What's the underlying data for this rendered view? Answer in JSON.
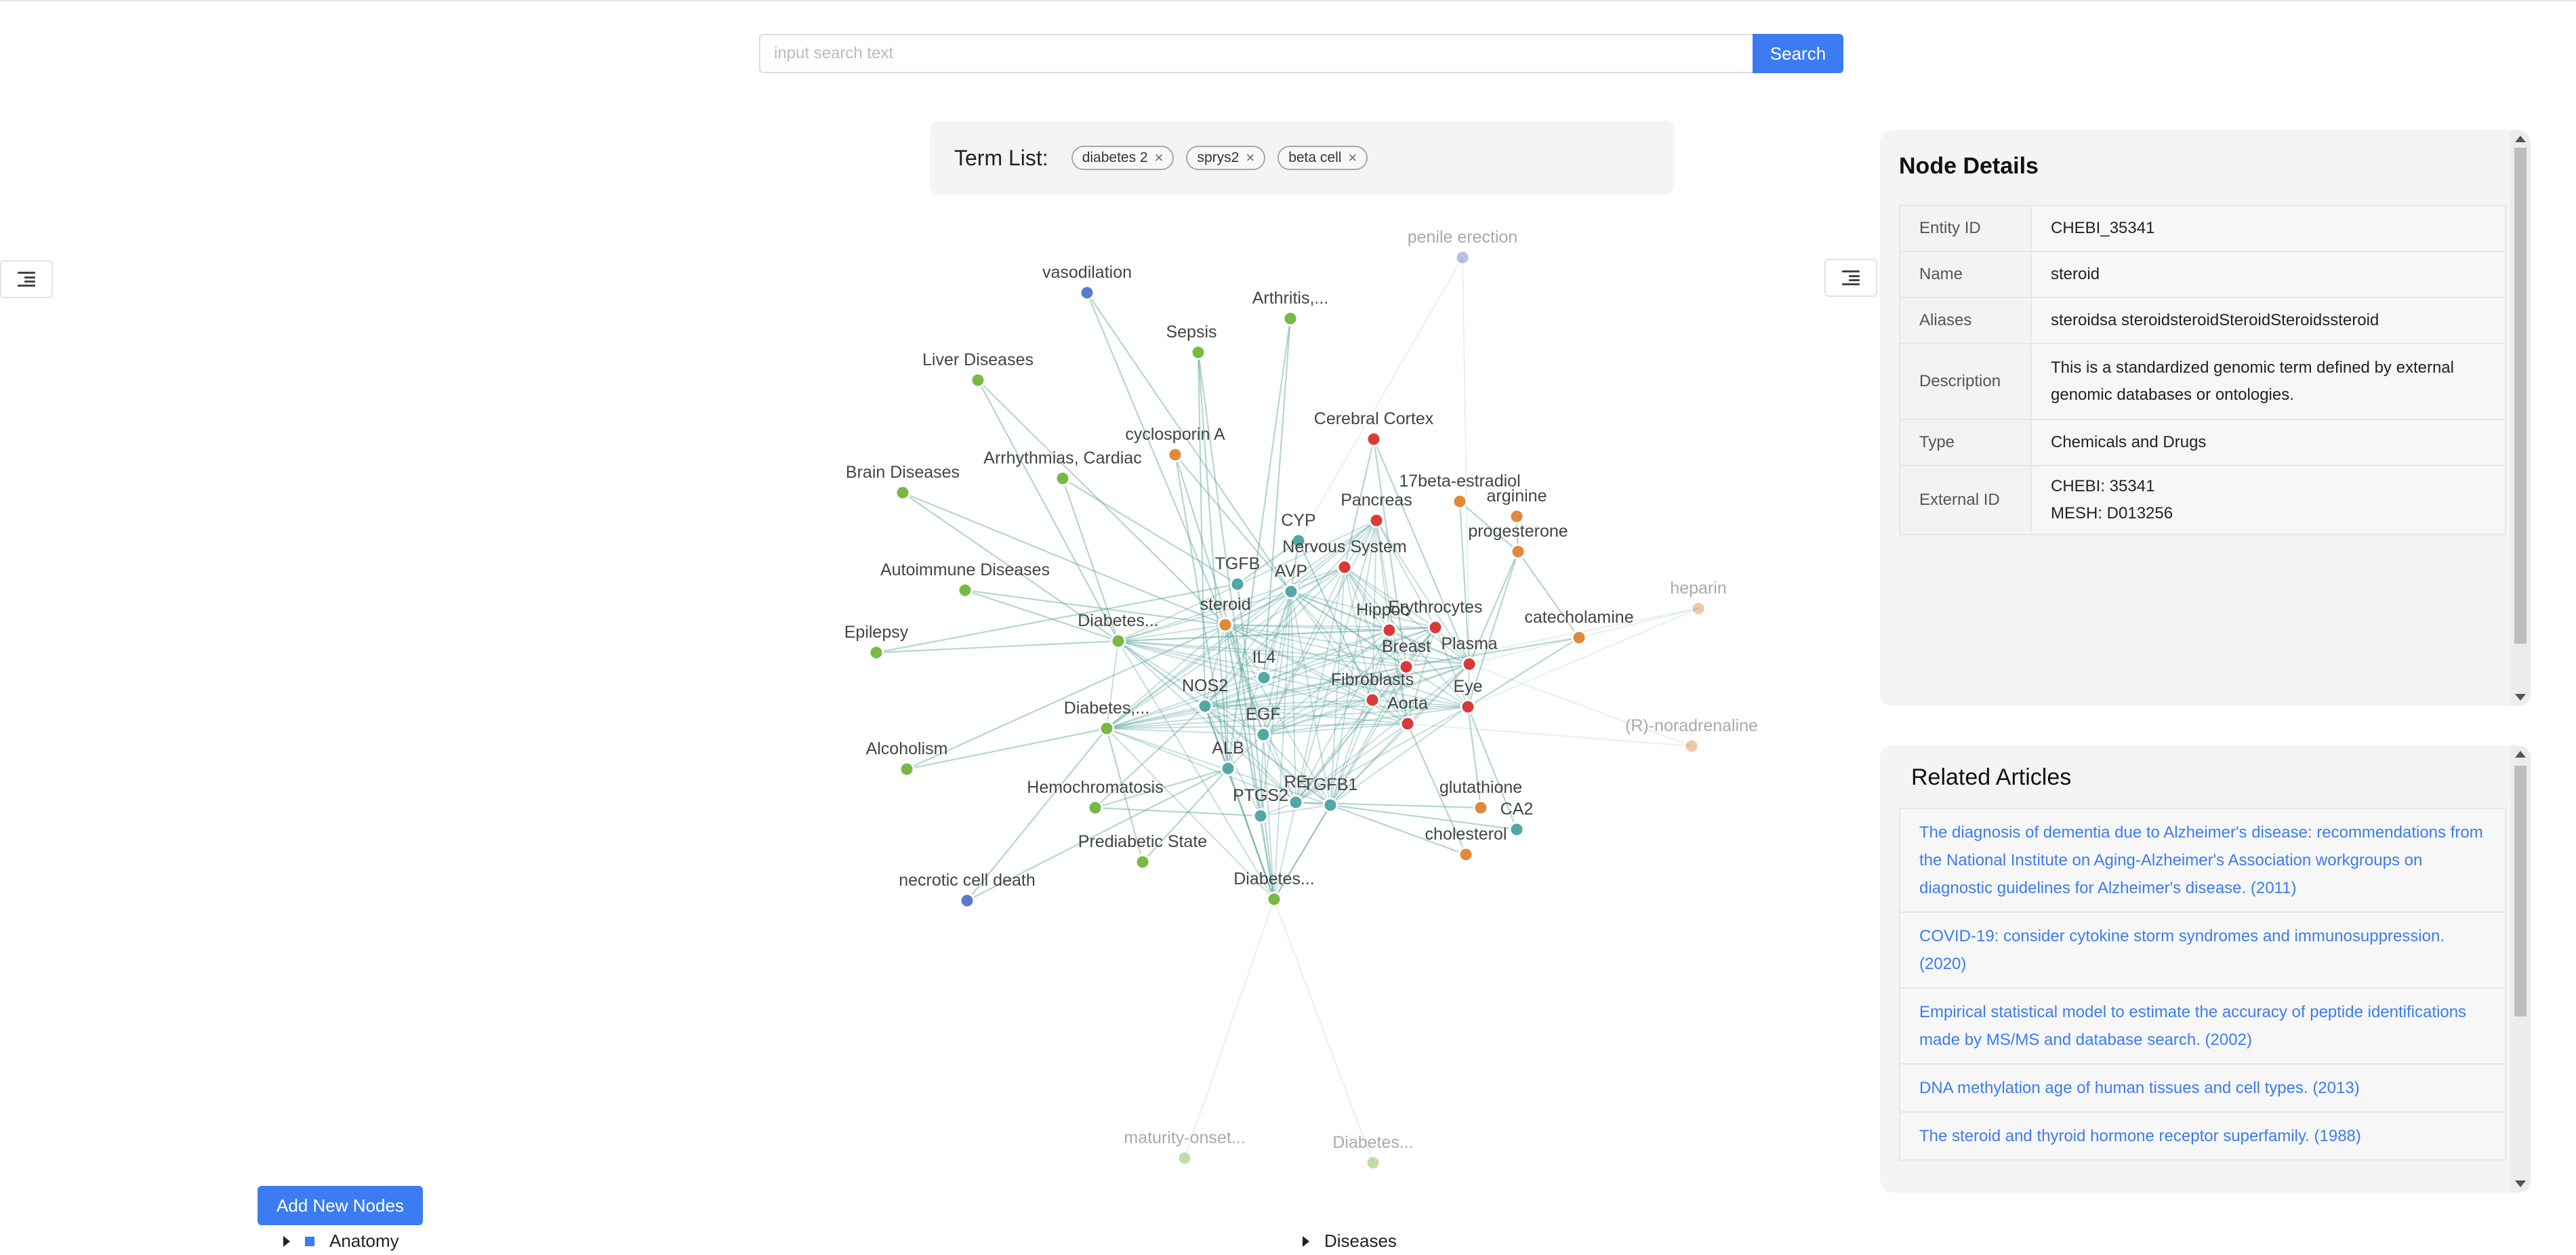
{
  "search": {
    "placeholder": "input search text",
    "button_label": "Search"
  },
  "term_list": {
    "label": "Term List:",
    "terms": [
      "diabetes 2",
      "sprys2",
      "beta cell"
    ],
    "close_glyph": "×"
  },
  "icons": {
    "sidebar_toggle": "menu-indent-icon",
    "tag_close": "close-icon"
  },
  "colors": {
    "primary": "#3b7cf2",
    "edge": "#5aa39c",
    "disease": "#79b843",
    "anatomy": "#d83a3a",
    "gene": "#52a7a7",
    "chemical": "#e0883b",
    "process": "#5b7bc9"
  },
  "graph": {
    "nodes": [
      {
        "label": "vasodilation",
        "group": "process"
      },
      {
        "label": "penile erection",
        "group": "process",
        "faded": true
      },
      {
        "label": "Arthritis,...",
        "group": "disease"
      },
      {
        "label": "Sepsis",
        "group": "disease"
      },
      {
        "label": "Liver Diseases",
        "group": "disease"
      },
      {
        "label": "cyclosporin A",
        "group": "chemical"
      },
      {
        "label": "Cerebral Cortex",
        "group": "anatomy"
      },
      {
        "label": "Arrhythmias, Cardiac",
        "group": "disease"
      },
      {
        "label": "Brain Diseases",
        "group": "disease"
      },
      {
        "label": "17beta-estradiol",
        "group": "chemical"
      },
      {
        "label": "arginine",
        "group": "chemical"
      },
      {
        "label": "Pancreas",
        "group": "anatomy"
      },
      {
        "label": "CYP",
        "group": "gene"
      },
      {
        "label": "progesterone",
        "group": "chemical"
      },
      {
        "label": "Nervous System",
        "group": "anatomy"
      },
      {
        "label": "TGFB",
        "group": "gene"
      },
      {
        "label": "AVP",
        "group": "gene"
      },
      {
        "label": "Autoimmune Diseases",
        "group": "disease"
      },
      {
        "label": "heparin",
        "group": "chemical",
        "faded": true
      },
      {
        "label": "steroid",
        "group": "chemical"
      },
      {
        "label": "Hippoc",
        "group": "anatomy"
      },
      {
        "label": "Erythrocytes",
        "group": "anatomy"
      },
      {
        "label": "Diabetes...",
        "group": "disease"
      },
      {
        "label": "catecholamine",
        "group": "chemical"
      },
      {
        "label": "Epilepsy",
        "group": "disease"
      },
      {
        "label": "Breast",
        "group": "anatomy"
      },
      {
        "label": "Plasma",
        "group": "anatomy"
      },
      {
        "label": "IL4",
        "group": "gene"
      },
      {
        "label": "Fibroblasts",
        "group": "anatomy"
      },
      {
        "label": "NOS2",
        "group": "gene"
      },
      {
        "label": "Eye",
        "group": "anatomy"
      },
      {
        "label": "Aorta",
        "group": "anatomy"
      },
      {
        "label": "Diabetes,...",
        "group": "disease"
      },
      {
        "label": "EGF",
        "group": "gene"
      },
      {
        "label": "(R)-noradrenaline",
        "group": "chemical",
        "faded": true
      },
      {
        "label": "Alcoholism",
        "group": "disease"
      },
      {
        "label": "ALB",
        "group": "gene"
      },
      {
        "label": "glutathione",
        "group": "chemical"
      },
      {
        "label": "Hemochromatosis",
        "group": "disease"
      },
      {
        "label": "RE",
        "group": "gene"
      },
      {
        "label": "TGFB1",
        "group": "gene"
      },
      {
        "label": "CA2",
        "group": "gene"
      },
      {
        "label": "PTGS2",
        "group": "gene"
      },
      {
        "label": "cholesterol",
        "group": "chemical"
      },
      {
        "label": "Prediabetic State",
        "group": "disease"
      },
      {
        "label": "necrotic cell death",
        "group": "process"
      },
      {
        "label": "Diabetes...",
        "group": "disease"
      },
      {
        "label": "maturity-onset...",
        "group": "disease",
        "faded": true
      },
      {
        "label": "Diabetes...",
        "group": "disease",
        "faded": true
      }
    ]
  },
  "node_details": {
    "title": "Node Details",
    "rows": [
      {
        "key": "Entity ID",
        "value": "CHEBI_35341"
      },
      {
        "key": "Name",
        "value": "steroid"
      },
      {
        "key": "Aliases",
        "value": "steroidsa steroidsteroidSteroidSteroidssteroid"
      },
      {
        "key": "Description",
        "value": "This is a standardized genomic term defined by external genomic databases or ontologies."
      },
      {
        "key": "Type",
        "value": "Chemicals and Drugs"
      },
      {
        "key": "External ID",
        "value": "CHEBI: 35341",
        "value2": "MESH: D013256"
      }
    ]
  },
  "related_articles": {
    "title": "Related Articles",
    "items": [
      "The diagnosis of dementia due to Alzheimer's disease: recommendations from the National Institute on Aging-Alzheimer's Association workgroups on diagnostic guidelines for Alzheimer's disease. (2011)",
      "COVID-19: consider cytokine storm syndromes and immunosuppression. (2020)",
      "Empirical statistical model to estimate the accuracy of peptide identifications made by MS/MS and database search. (2002)",
      "DNA methylation age of human tissues and cell types. (2013)",
      "The steroid and thyroid hormone receptor superfamily. (1988)"
    ]
  },
  "bottom": {
    "add_nodes_label": "Add New Nodes",
    "legend": [
      {
        "label": "Anatomy",
        "color": "#3b7cf2"
      },
      {
        "label": "Diseases"
      }
    ]
  }
}
